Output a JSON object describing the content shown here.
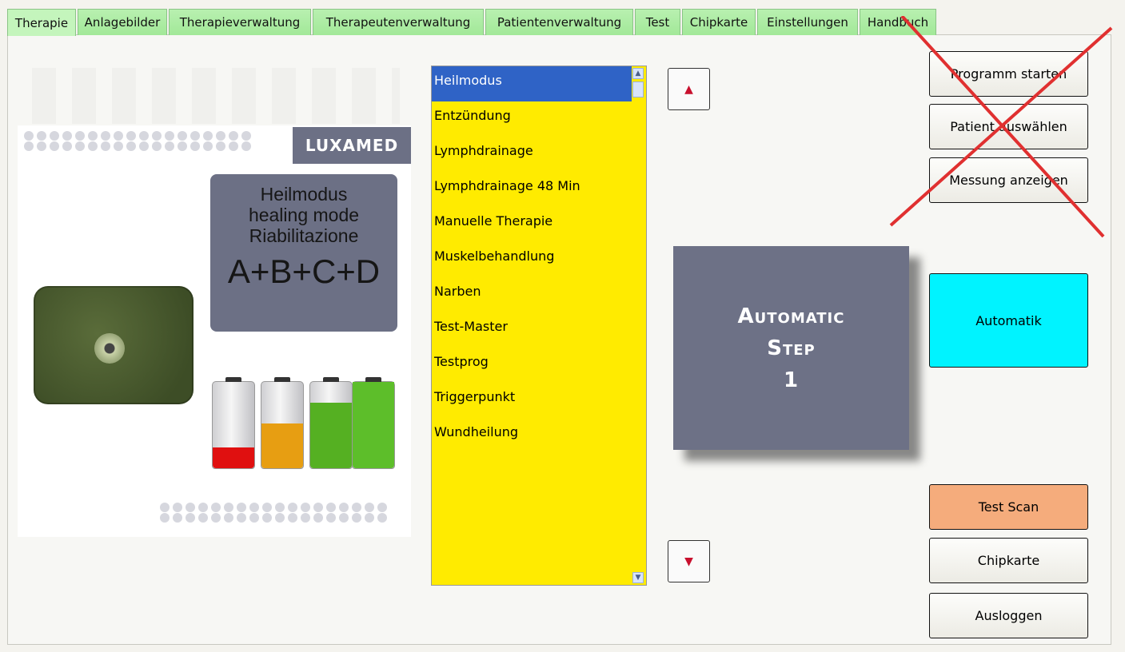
{
  "tabs": [
    "Therapie",
    "Anlagebilder",
    "Therapieverwaltung",
    "Therapeutenverwaltung",
    "Patientenverwaltung",
    "Test",
    "Chipkarte",
    "Einstellungen",
    "Handbuch"
  ],
  "image": {
    "logo_text": "LUXAMED",
    "mode_lines": [
      "Heilmodus",
      "healing mode",
      "Riabilitazione"
    ],
    "channels": "A+B+C+D"
  },
  "program_list": {
    "items": [
      "Heilmodus",
      "Entzündung",
      "Lymphdrainage",
      "Lymphdrainage 48 Min",
      "Manuelle Therapie",
      "Muskelbehandlung",
      "Narben",
      "Test-Master",
      "Testprog",
      "Triggerpunkt",
      "Wundheilung"
    ],
    "selected_index": 0
  },
  "nav": {
    "up_icon": "arrow-up-icon",
    "down_icon": "arrow-down-icon"
  },
  "overlay": {
    "line1": "Automatic",
    "line2": "Step",
    "line3": "1"
  },
  "buttons": {
    "start": "Programm starten",
    "select_patient": "Patient auswählen",
    "show_measurement": "Messung anzeigen",
    "automatik": "Automatik",
    "test_scan": "Test Scan",
    "chipkarte": "Chipkarte",
    "logout": "Ausloggen"
  },
  "colors": {
    "tab": "#a8ea9e",
    "list_bg": "#ffeb00",
    "selection": "#2f63c6",
    "automatik": "#00f3ff",
    "test_scan": "#f5ac7c",
    "cross": "#e03030"
  }
}
